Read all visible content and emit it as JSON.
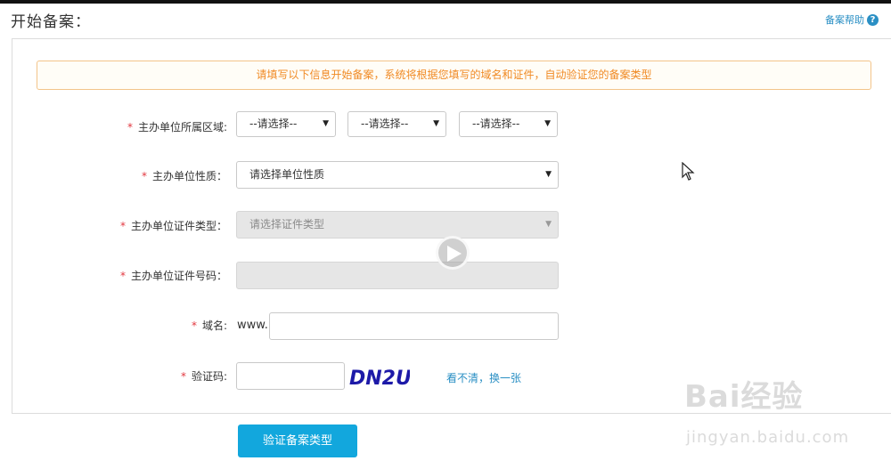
{
  "page": {
    "title": "开始备案："
  },
  "help": {
    "label": "备案帮助",
    "icon": "help-circle-icon",
    "icon_glyph": "?"
  },
  "notice": {
    "text": "请填写以下信息开始备案，系统将根据您填写的域名和证件，自动验证您的备案类型"
  },
  "form": {
    "required_mark": "*",
    "region": {
      "label": "主办单位所属区域:",
      "selects": [
        "--请选择--",
        "--请选择--",
        "--请选择--"
      ]
    },
    "nature": {
      "label": "主办单位性质：",
      "value": "请选择单位性质"
    },
    "cert_type": {
      "label": "主办单位证件类型：",
      "value": "请选择证件类型",
      "disabled": true
    },
    "cert_no": {
      "label": "主办单位证件号码：",
      "value": "",
      "disabled": true
    },
    "domain": {
      "label": "域名:",
      "prefix": "www.",
      "value": ""
    },
    "captcha": {
      "label": "验证码:",
      "value": "",
      "image_text": "DN2U",
      "refresh_label": "看不清，换一张"
    }
  },
  "submit": {
    "label": "验证备案类型"
  },
  "overlay": {
    "play_icon": "play-circle-icon",
    "cursor_icon": "mouse-pointer-icon"
  },
  "watermark": {
    "logo": "Bai经验",
    "url": "jingyan.baidu.com"
  },
  "colors": {
    "accent": "#12a7dd",
    "link": "#2a8fc4",
    "notice": "#f08a24",
    "required": "#e2373f"
  }
}
